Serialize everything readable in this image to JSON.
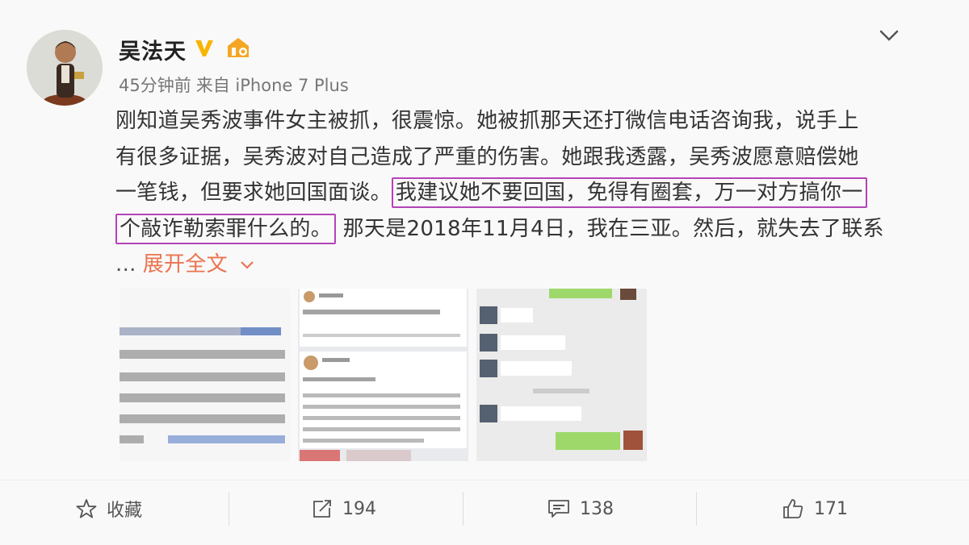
{
  "post": {
    "username": "吴法天",
    "time": "45分钟前",
    "source": "来自 iPhone 7 Plus",
    "lines": [
      "刚知道吴秀波事件女主被抓，很震惊。她被抓那天还打微信电话咨询我，说手上",
      "有很多证据，吴秀波对自己造成了严重的伤害。她跟我透露，吴秀波愿意赔偿她",
      "一笔钱，但要求她回国面谈。",
      "我建议她不要回国，免得有圈套，万一对方搞你一",
      "个敲诈勒索罪什么的。",
      "那天是2018年11月4日，我在三亚。然后，就失去了联系"
    ],
    "ellipsis": "...",
    "expand_label": "展开全文"
  },
  "icons": {
    "verified": "verified-v-icon",
    "member": "member-crown-icon",
    "menu": "chevron-down-icon",
    "favorite": "star-icon",
    "repost": "repost-icon",
    "comment": "comment-icon",
    "like": "thumbs-up-icon"
  },
  "colors": {
    "highlight_border": "#b344b8",
    "expand_link": "#eb7350",
    "verified": "#f7b500"
  },
  "actions": {
    "favorite_label": "收藏",
    "repost_count": "194",
    "comment_count": "138",
    "like_count": "171"
  }
}
